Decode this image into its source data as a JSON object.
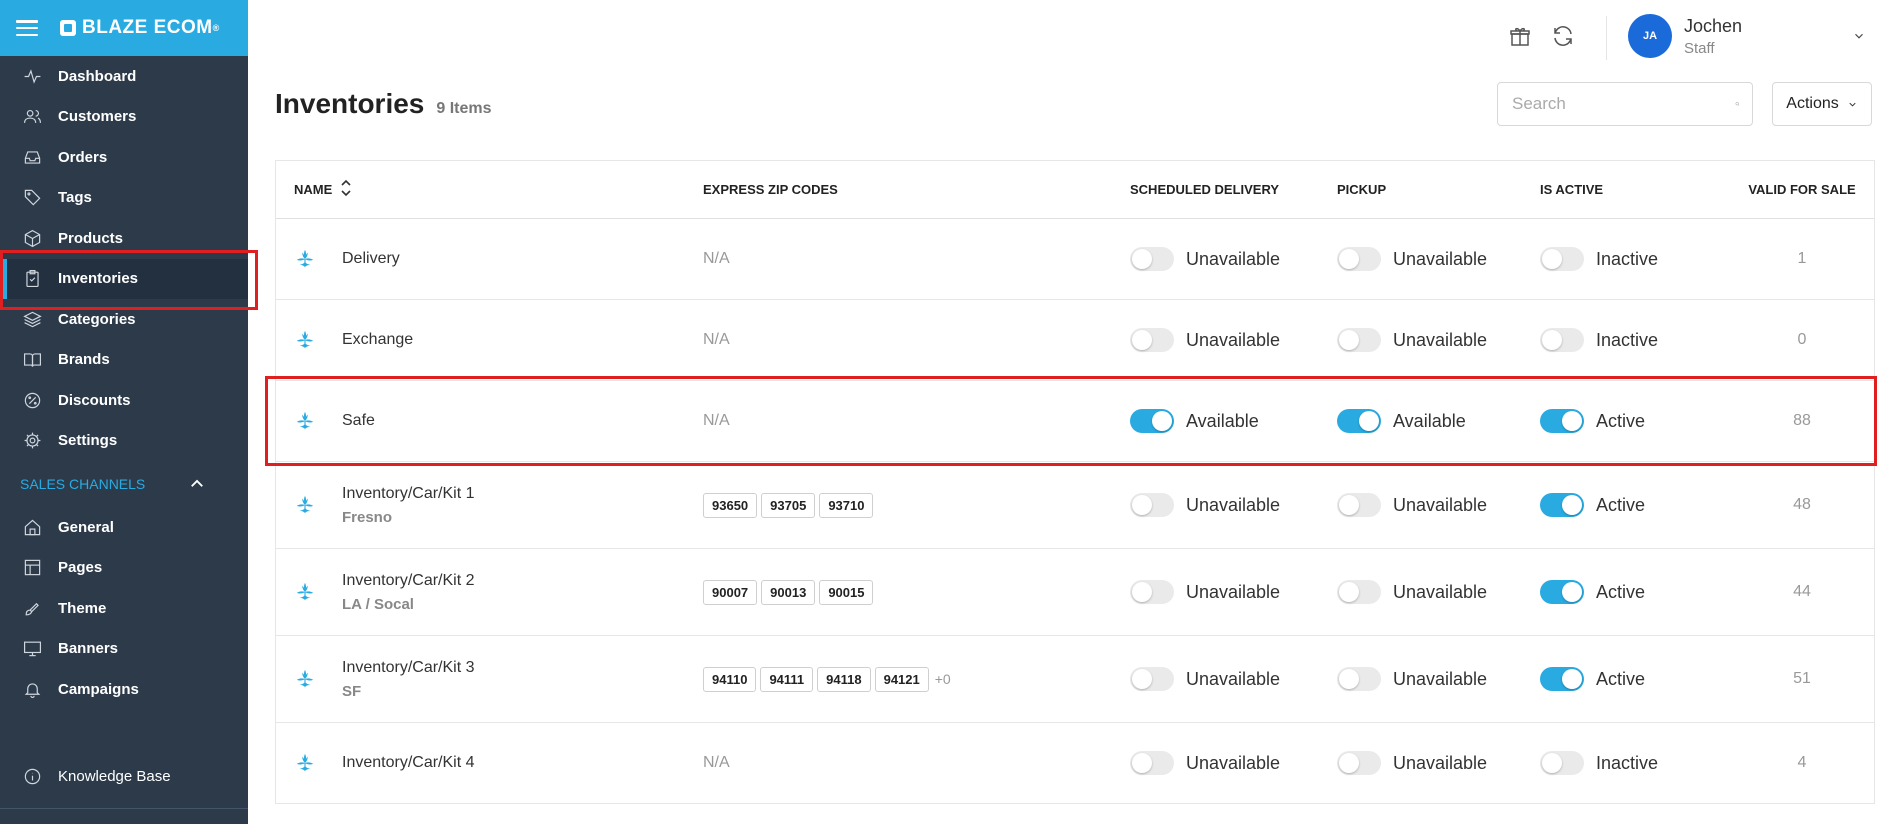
{
  "brand": {
    "name": "BLAZE ECOM"
  },
  "sidebar": {
    "items": [
      {
        "label": "Dashboard",
        "icon": "activity-icon"
      },
      {
        "label": "Customers",
        "icon": "users-icon"
      },
      {
        "label": "Orders",
        "icon": "inbox-icon"
      },
      {
        "label": "Tags",
        "icon": "tag-icon"
      },
      {
        "label": "Products",
        "icon": "box-icon"
      },
      {
        "label": "Inventories",
        "icon": "clipboard-icon",
        "active": true
      },
      {
        "label": "Categories",
        "icon": "layers-icon"
      },
      {
        "label": "Brands",
        "icon": "book-icon"
      },
      {
        "label": "Discounts",
        "icon": "percent-icon"
      },
      {
        "label": "Settings",
        "icon": "gear-icon"
      }
    ],
    "sales_channels_label": "SALES CHANNELS",
    "channel_items": [
      {
        "label": "General",
        "icon": "home-icon"
      },
      {
        "label": "Pages",
        "icon": "layout-icon"
      },
      {
        "label": "Theme",
        "icon": "brush-icon"
      },
      {
        "label": "Banners",
        "icon": "monitor-icon"
      },
      {
        "label": "Campaigns",
        "icon": "bell-icon"
      }
    ],
    "knowledge_base": "Knowledge Base"
  },
  "user": {
    "initials": "JA",
    "name": "Jochen",
    "role": "Staff"
  },
  "page": {
    "title": "Inventories",
    "count": "9 Items"
  },
  "search": {
    "placeholder": "Search"
  },
  "actions_label": "Actions",
  "table": {
    "headers": {
      "name": "NAME",
      "zip": "EXPRESS ZIP CODES",
      "sched": "SCHEDULED DELIVERY",
      "pickup": "PICKUP",
      "active": "IS ACTIVE",
      "valid": "VALID FOR SALE"
    },
    "rows": [
      {
        "name": "Delivery",
        "sub": "",
        "zips": [],
        "zip_na": "N/A",
        "more": "",
        "sched": "Unavailable",
        "sched_on": false,
        "pickup": "Unavailable",
        "pickup_on": false,
        "active": "Inactive",
        "active_on": false,
        "valid": "1"
      },
      {
        "name": "Exchange",
        "sub": "",
        "zips": [],
        "zip_na": "N/A",
        "more": "",
        "sched": "Unavailable",
        "sched_on": false,
        "pickup": "Unavailable",
        "pickup_on": false,
        "active": "Inactive",
        "active_on": false,
        "valid": "0"
      },
      {
        "name": "Safe",
        "sub": "",
        "zips": [],
        "zip_na": "N/A",
        "more": "",
        "sched": "Available",
        "sched_on": true,
        "pickup": "Available",
        "pickup_on": true,
        "active": "Active",
        "active_on": true,
        "valid": "88"
      },
      {
        "name": "Inventory/Car/Kit 1",
        "sub": "Fresno",
        "zips": [
          "93650",
          "93705",
          "93710"
        ],
        "zip_na": "",
        "more": "",
        "sched": "Unavailable",
        "sched_on": false,
        "pickup": "Unavailable",
        "pickup_on": false,
        "active": "Active",
        "active_on": true,
        "valid": "48"
      },
      {
        "name": "Inventory/Car/Kit 2",
        "sub": "LA / Socal",
        "zips": [
          "90007",
          "90013",
          "90015"
        ],
        "zip_na": "",
        "more": "",
        "sched": "Unavailable",
        "sched_on": false,
        "pickup": "Unavailable",
        "pickup_on": false,
        "active": "Active",
        "active_on": true,
        "valid": "44"
      },
      {
        "name": "Inventory/Car/Kit 3",
        "sub": "SF",
        "zips": [
          "94110",
          "94111",
          "94118",
          "94121"
        ],
        "zip_na": "",
        "more": "+0",
        "sched": "Unavailable",
        "sched_on": false,
        "pickup": "Unavailable",
        "pickup_on": false,
        "active": "Active",
        "active_on": true,
        "valid": "51"
      },
      {
        "name": "Inventory/Car/Kit 4",
        "sub": "",
        "zips": [],
        "zip_na": "N/A",
        "more": "",
        "sched": "Unavailable",
        "sched_on": false,
        "pickup": "Unavailable",
        "pickup_on": false,
        "active": "Inactive",
        "active_on": false,
        "valid": "4"
      }
    ]
  },
  "colors": {
    "brand_blue": "#29abe2",
    "sidebar_bg": "#2c3a4a",
    "highlight_red": "#e02020"
  }
}
